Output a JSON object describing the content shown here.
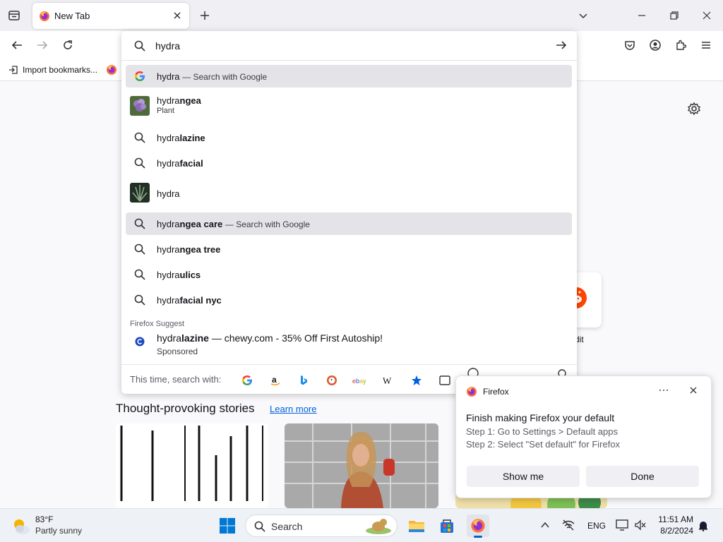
{
  "browser": {
    "tab_title": "New Tab",
    "bookmark_import_label": "Import bookmarks...",
    "accent_color": "#0061e0"
  },
  "urlbar": {
    "query": "hydra",
    "results": [
      {
        "typed": "hydra",
        "completion": "",
        "suffix": "— Search with Google",
        "icon": "google-icon",
        "highlighted": true
      },
      {
        "typed": "hydra",
        "completion": "ngea",
        "subtitle": "Plant",
        "icon": "hydrangea-thumbnail"
      },
      {
        "typed": "hydra",
        "completion": "lazine",
        "icon": "search-icon"
      },
      {
        "typed": "hydra",
        "completion": "facial",
        "icon": "search-icon"
      },
      {
        "typed": "hydra",
        "completion": "",
        "icon": "hydra-thumbnail"
      },
      {
        "typed": "hydra",
        "completion": "ngea care",
        "suffix": "— Search with Google",
        "icon": "search-icon",
        "highlighted": true
      },
      {
        "typed": "hydra",
        "completion": "ngea tree",
        "icon": "search-icon"
      },
      {
        "typed": "hydra",
        "completion": "ulics",
        "icon": "search-icon"
      },
      {
        "typed": "hydra",
        "completion": "facial nyc",
        "icon": "search-icon"
      }
    ],
    "suggest_label": "Firefox Suggest",
    "sponsored": {
      "typed": "hydra",
      "completion": "lazine",
      "rest": " — chewy.com - 35% Off First Autoship!",
      "tag": "Sponsored"
    },
    "engine_prompt": "This time, search with:",
    "engines": [
      "google-icon",
      "amazon-icon",
      "bing-icon",
      "duckduckgo-icon",
      "ebay-icon",
      "wikipedia-icon",
      "bookmarks-icon",
      "tabs-icon",
      "history-icon",
      "actions-icon"
    ]
  },
  "newtab": {
    "shortcut_label": "dit",
    "stories_heading": "Thought-provoking stories",
    "stories_link": "Learn more"
  },
  "notification": {
    "app_name": "Firefox",
    "heading": "Finish making Firefox your default",
    "step1": "Step 1: Go to Settings > Default apps",
    "step2": "Step 2: Select \"Set default\" for Firefox",
    "primary_button": "Show me",
    "secondary_button": "Done"
  },
  "taskbar": {
    "weather_temp": "83°F",
    "weather_condition": "Partly sunny",
    "search_placeholder": "Search",
    "language": "ENG",
    "time": "11:51 AM",
    "date": "8/2/2024"
  }
}
